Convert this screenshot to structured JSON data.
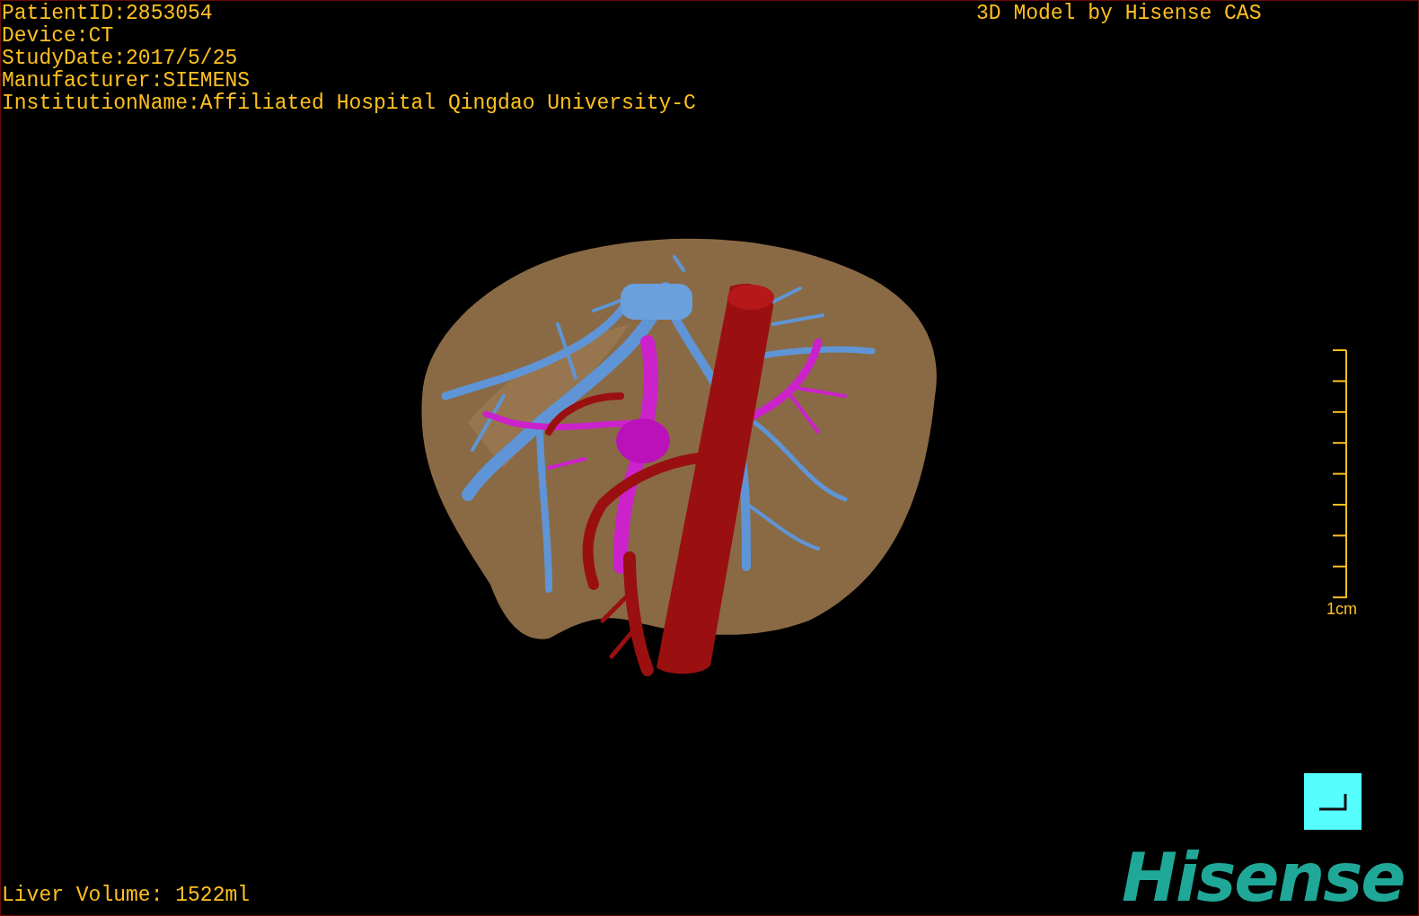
{
  "info_lines": [
    "PatientID:2853054",
    "Device:CT",
    "StudyDate:2017/5/25",
    "Manufacturer:SIEMENS",
    "InstitutionName:Affiliated Hospital Qingdao University-C"
  ],
  "title_right": "3D Model by Hisense CAS",
  "scale_bar": {
    "label": "1cm"
  },
  "liver_volume": "Liver Volume: 1522ml",
  "logo": "Hisense"
}
